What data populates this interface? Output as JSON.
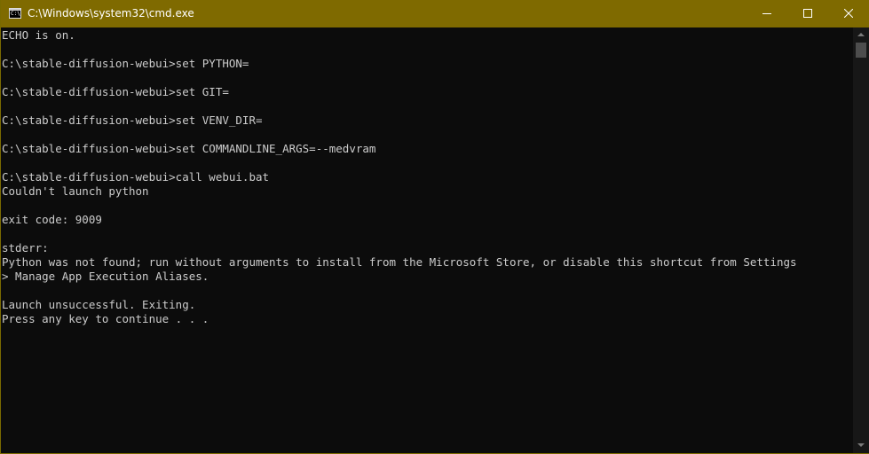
{
  "window": {
    "title": "C:\\Windows\\system32\\cmd.exe",
    "icon": "console-icon",
    "icon_text": "C:\\",
    "accent_color": "#7f6a00"
  },
  "controls": {
    "minimize": "minimize-icon",
    "maximize": "maximize-icon",
    "close": "close-icon"
  },
  "console": {
    "lines": [
      "ECHO is on.",
      "",
      "C:\\stable-diffusion-webui>set PYTHON=",
      "",
      "C:\\stable-diffusion-webui>set GIT=",
      "",
      "C:\\stable-diffusion-webui>set VENV_DIR=",
      "",
      "C:\\stable-diffusion-webui>set COMMANDLINE_ARGS=--medvram",
      "",
      "C:\\stable-diffusion-webui>call webui.bat",
      "Couldn't launch python",
      "",
      "exit code: 9009",
      "",
      "stderr:",
      "Python was not found; run without arguments to install from the Microsoft Store, or disable this shortcut from Settings",
      "> Manage App Execution Aliases.",
      "",
      "Launch unsuccessful. Exiting.",
      "Press any key to continue . . ."
    ]
  }
}
